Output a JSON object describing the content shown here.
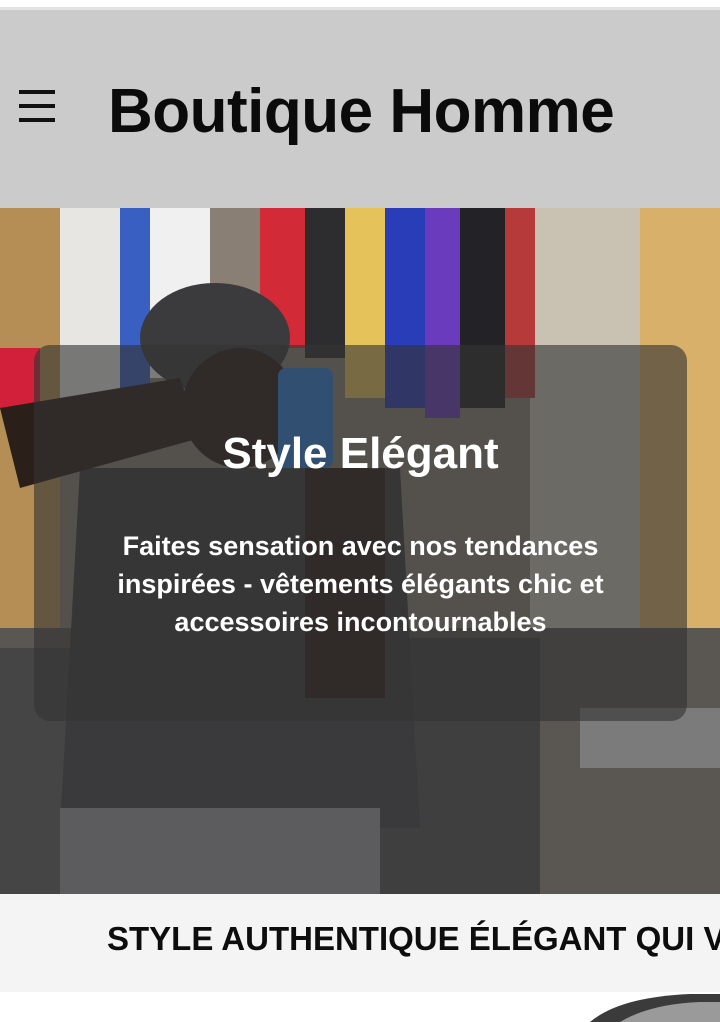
{
  "header": {
    "site_title": "Boutique Homme",
    "menu_icon": "hamburger-menu-icon",
    "background": "#cbcbcb"
  },
  "hero": {
    "title": "Style Elégant",
    "text": "Faites sensation avec nos tendances inspirées - vêtements élégants chic et accessoires incontournables",
    "overlay_color": "rgba(52,52,52,0.62)"
  },
  "ticker": {
    "text": "STYLE AUTHENTIQUE ÉLÉGANT QUI V"
  }
}
